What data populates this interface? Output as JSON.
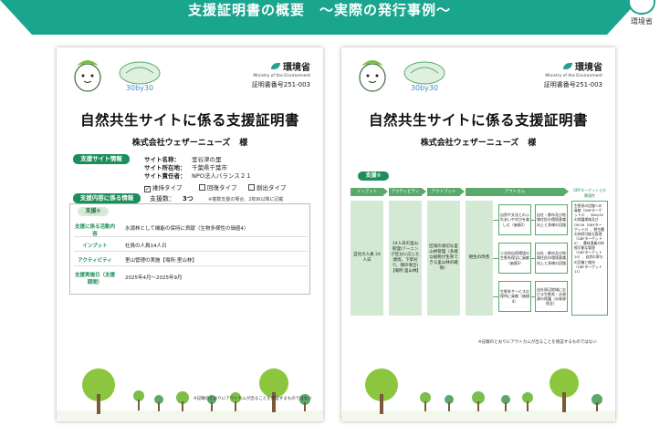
{
  "header": {
    "title": "支援証明書の概要　～実際の発行事例～",
    "logo_label": "環境省"
  },
  "colors": {
    "brand_green": "#1aa58e",
    "pill_green": "#1b8e5a",
    "box_green": "#d3e9d3"
  },
  "certificate": {
    "ministry_name": "環境省",
    "ministry_en": "Ministry of the Environment",
    "badge_text": "30by30",
    "number": "証明書番号251-003",
    "title": "自然共生サイトに係る支援証明書",
    "company": "株式会社ウェザーニューズ",
    "honorific": "様"
  },
  "left": {
    "site_info_label": "支援サイト情報",
    "site_rows": [
      {
        "key": "サイト名称：",
        "value": "室谷津の里"
      },
      {
        "key": "サイト所在地：",
        "value": "千葉県千葉市"
      },
      {
        "key": "サイト責任者：",
        "value": "NPO法人バランス２１"
      }
    ],
    "types": [
      {
        "label": "維持タイプ",
        "checked": "✓"
      },
      {
        "label": "回復タイプ",
        "checked": ""
      },
      {
        "label": "創出タイプ",
        "checked": ""
      }
    ],
    "support_info_label": "支援内容に係る情報",
    "count_label": "支援数：",
    "count_value": "3つ",
    "count_note": "※複数支援の場合、2枚目以降に記載",
    "support_head": "支援①",
    "support_rows": [
      {
        "key": "支援に係る活動内容",
        "value": "水源林として機能の保持に貢献（生物多様性の価値4）"
      },
      {
        "key": "インプット",
        "value": "社員の人員14人日"
      },
      {
        "key": "アクティビティ",
        "value": "里山管理の実施【場所:里山林】"
      },
      {
        "key": "支援実施日（支援期間）",
        "value": "2025年4月～2025年9月"
      }
    ],
    "footnote": "※記載のとおりにアウトカムが出ることを保証するものではない"
  },
  "right": {
    "flow_head": "支援①",
    "stages": [
      "インプット",
      "アクティビティ",
      "アウトプット",
      "アウトカム"
    ],
    "sdg_label": "GBFターゲットとの関連性",
    "input_text": "自社の人員 24人日",
    "activity_text": "14人日の里山管理(ゾーニング区分に応じた間伐、下草刈り、間の保全)【場所:里山林】",
    "output_text": "区域の適切な里山林管理（多様な植物が生育できる里山林の確保）",
    "outcome_main": "樹生の改善",
    "outcome_boxes": [
      "自然や文化とのふれあいや学びを楽しむ（価値2）",
      "二次的自然環境の生態系保全に貢献（価値3）",
      "生態系サービスの保持に貢献（価値4）"
    ],
    "outcome_boxes2": [
      "自社・都市及び地域住民の環境意識向上と多様の回復",
      "自社・都市及び地域住民の環境意識向上と多様の回復",
      "自社周辺地域における生態系・水資源の保護（水資源保全）"
    ],
    "sdg_text": "生態系の回復への貢献（GBFターゲット2）、30by30の保護地域及びOECM（GBFターゲット3）、野生種の持続可能な管理（GBFターゲット5）、農林漁業の持続可能な管理（GBFターゲット10）、自然の寄与の回復と維持（GBFターゲット11）",
    "footnote": "※記載のとおりにアウトカムが出ることを保証するものではない"
  }
}
